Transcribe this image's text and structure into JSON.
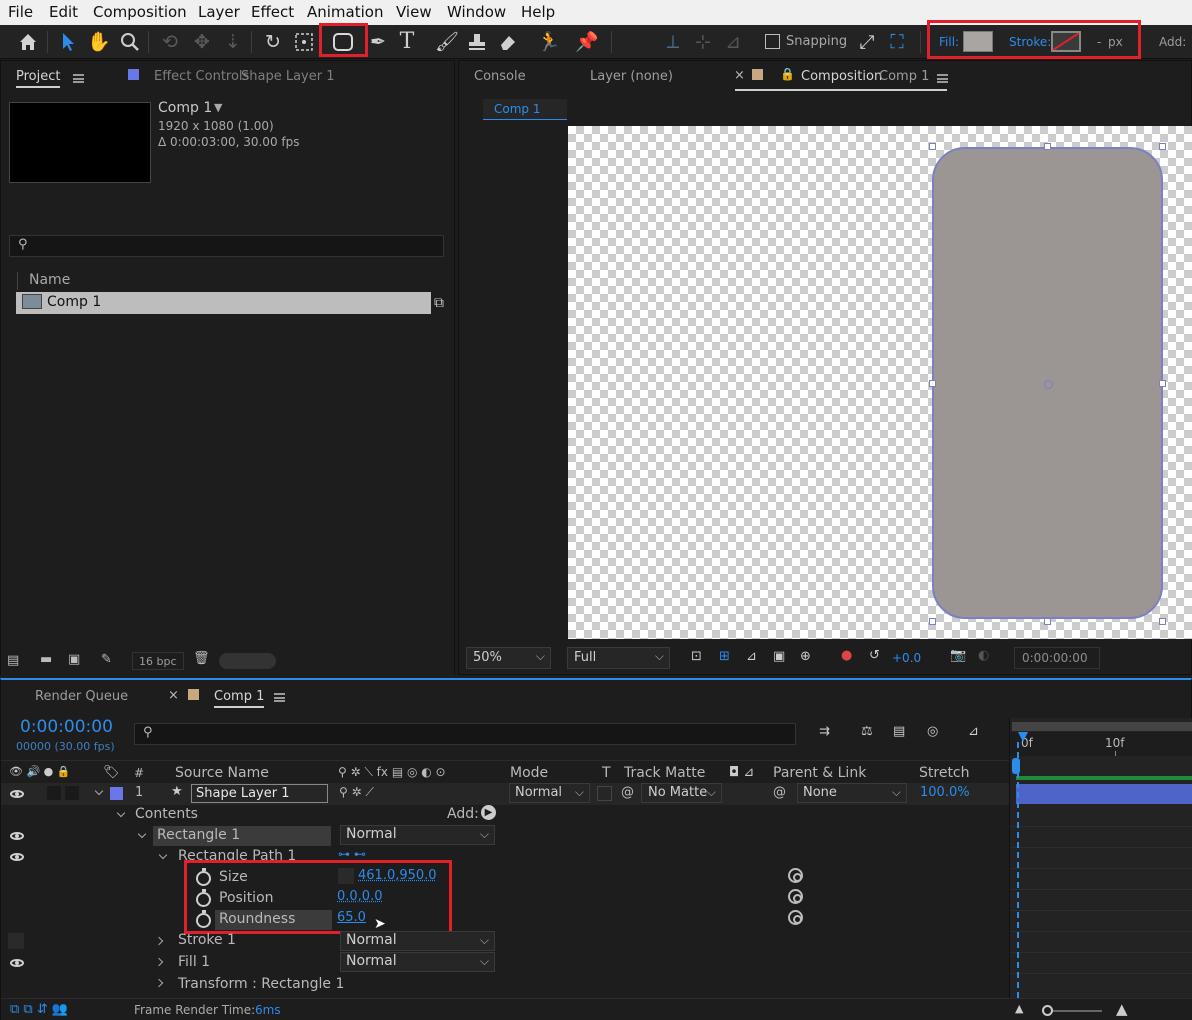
{
  "menu": [
    "File",
    "Edit",
    "Composition",
    "Layer",
    "Effect",
    "Animation",
    "View",
    "Window",
    "Help"
  ],
  "toolbar": {
    "snapping_label": "Snapping",
    "fill_label": "Fill:",
    "stroke_label": "Stroke:",
    "stroke_width": "-",
    "stroke_unit": "px",
    "add_label": "Add:",
    "fill_color": "#a9a5a2"
  },
  "project_panel": {
    "tab_project": "Project",
    "tab_effect_controls": "Effect Controls",
    "tab_effect_controls_layer": "Shape Layer 1",
    "comp_name": "Comp 1",
    "comp_resolution": "1920 x 1080 (1.00)",
    "comp_duration": "Δ 0:00:03:00, 30.00 fps",
    "search_placeholder": "",
    "column_name": "Name",
    "items": [
      {
        "name": "Comp 1"
      }
    ],
    "bpc": "16 bpc"
  },
  "viewer": {
    "tab_console": "Console",
    "tab_layer": "Layer (none)",
    "tab_composition": "Composition",
    "tab_composition_name": "Comp 1",
    "breadcrumb": "Comp 1",
    "zoom": "50%",
    "resolution": "Full",
    "exposure": "+0.0",
    "timecode": "0:00:00:00"
  },
  "timeline": {
    "tab_render_queue": "Render Queue",
    "tab_comp": "Comp 1",
    "timecode": "0:00:00:00",
    "frame_info": "00000 (30.00 fps)",
    "columns": {
      "num": "#",
      "source_name": "Source Name",
      "mode": "Mode",
      "t": "T",
      "track_matte": "Track Matte",
      "parent": "Parent & Link",
      "stretch": "Stretch"
    },
    "layer": {
      "index": "1",
      "name": "Shape Layer 1",
      "mode": "Normal",
      "matte": "No Matte",
      "parent": "None",
      "stretch": "100.0%"
    },
    "contents_label": "Contents",
    "add_label": "Add:",
    "rectangle_group": "Rectangle 1",
    "rectangle_mode": "Normal",
    "rect_path": "Rectangle Path 1",
    "size_label": "Size",
    "size_value": "461.0,950.0",
    "position_label": "Position",
    "position_value": "0.0,0.0",
    "roundness_label": "Roundness",
    "roundness_value": "65.0",
    "stroke_label": "Stroke 1",
    "stroke_mode": "Normal",
    "fill_label": "Fill 1",
    "fill_mode": "Normal",
    "transform_label": "Transform : Rectangle 1",
    "frame_render_label": "Frame Render Time:",
    "frame_render_value": "6ms",
    "ruler": [
      "0f",
      "10f"
    ]
  },
  "colors": {
    "accent_blue": "#2d8ceb",
    "highlight_red": "#e0202a",
    "layer_label": "#6a77e8"
  }
}
